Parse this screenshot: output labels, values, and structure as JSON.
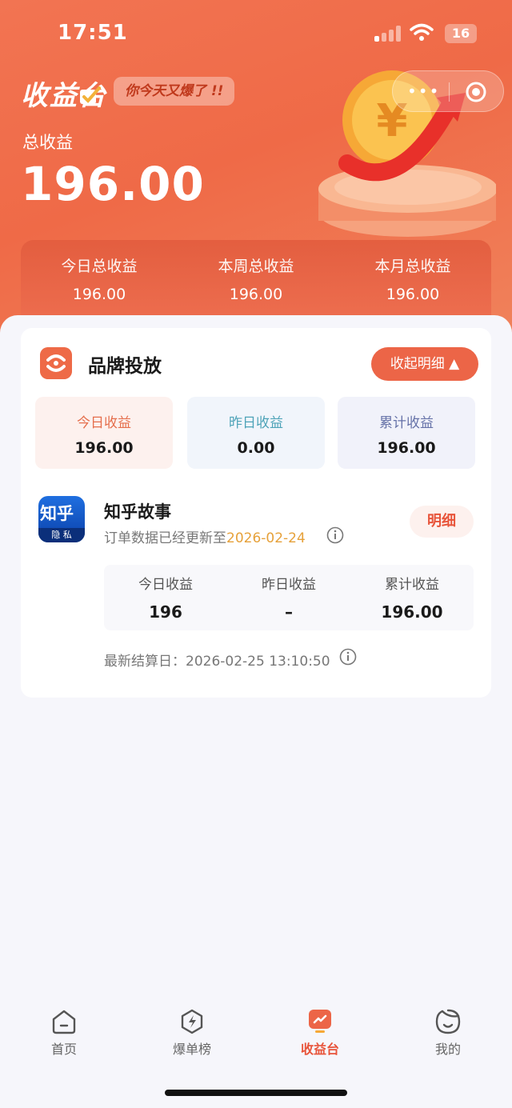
{
  "status_bar": {
    "time": "17:51",
    "battery": "16"
  },
  "header": {
    "title": "收益台",
    "slogan": "你今天又爆了 !!",
    "total_label": "总收益",
    "total_value": "196.00"
  },
  "summary": [
    {
      "label": "今日总收益",
      "value": "196.00"
    },
    {
      "label": "本周总收益",
      "value": "196.00"
    },
    {
      "label": "本月总收益",
      "value": "196.00"
    }
  ],
  "brand_card": {
    "title": "品牌投放",
    "collapse_label": "收起明细",
    "stats": [
      {
        "label": "今日收益",
        "value": "196.00"
      },
      {
        "label": "昨日收益",
        "value": "0.00"
      },
      {
        "label": "累计收益",
        "value": "196.00"
      }
    ],
    "app": {
      "icon_text": "知乎",
      "icon_sub": "隐 私",
      "name": "知乎故事",
      "update_prefix": "订单数据已经更新至",
      "update_date": "2026-02-24",
      "detail_label": "明细",
      "stats": [
        {
          "label": "今日收益",
          "value": "196"
        },
        {
          "label": "昨日收益",
          "value": "–"
        },
        {
          "label": "累计收益",
          "value": "196.00"
        }
      ],
      "settle_label": "最新结算日：",
      "settle_time": "2026-02-25 13:10:50"
    }
  },
  "tabs": [
    {
      "label": "首页",
      "icon": "home-icon"
    },
    {
      "label": "爆单榜",
      "icon": "lightning-icon"
    },
    {
      "label": "收益台",
      "icon": "earnings-icon"
    },
    {
      "label": "我的",
      "icon": "profile-face-icon"
    }
  ],
  "colors": {
    "header_orange": "#ef6a47",
    "accent_red": "#e8543a",
    "date_yellow": "#e6a13a"
  }
}
